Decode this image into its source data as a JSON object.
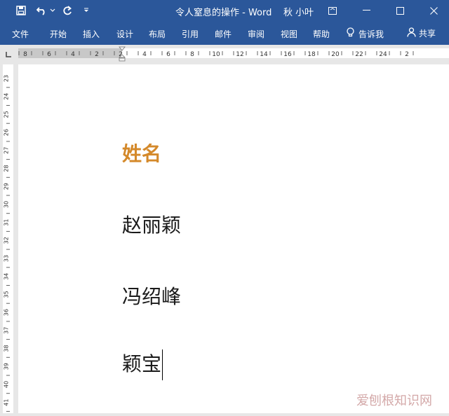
{
  "titlebar": {
    "title": "令人窒息的操作 - Word",
    "user": "秋 小叶"
  },
  "ribbon": {
    "tabs": [
      "文件",
      "开始",
      "插入",
      "设计",
      "布局",
      "引用",
      "邮件",
      "审阅",
      "视图",
      "帮助"
    ],
    "tell_me": "告诉我",
    "share": "共享"
  },
  "ruler": {
    "h_labels": [
      "8",
      "6",
      "4",
      "2",
      "2",
      "4",
      "6",
      "8",
      "10",
      "12",
      "14",
      "16",
      "18",
      "20",
      "22",
      "24",
      "2"
    ],
    "v_labels": [
      "23",
      "24",
      "25",
      "26",
      "27",
      "28",
      "29",
      "30",
      "31",
      "32",
      "33",
      "34",
      "35",
      "36",
      "37",
      "38",
      "39",
      "40",
      "41"
    ]
  },
  "document": {
    "heading": "姓名",
    "names": [
      "赵丽颖",
      "冯绍峰",
      "颖宝"
    ]
  },
  "watermark": "爱刨根知识网",
  "colors": {
    "ribbon": "#2b579a",
    "heading": "#d4892a"
  }
}
